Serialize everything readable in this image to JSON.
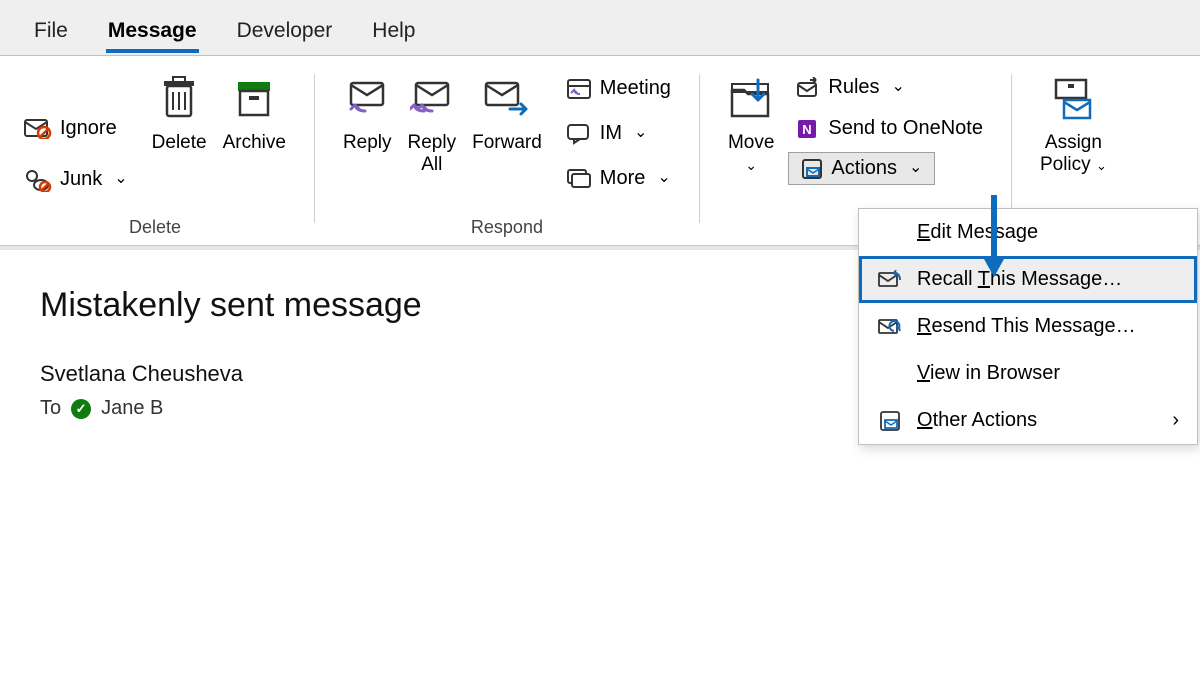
{
  "tabs": {
    "file": "File",
    "message": "Message",
    "developer": "Developer",
    "help": "Help"
  },
  "ribbon": {
    "ignore": "Ignore",
    "junk": "Junk",
    "delete": "Delete",
    "archive": "Archive",
    "reply": "Reply",
    "reply_all": "Reply\nAll",
    "forward": "Forward",
    "meeting": "Meeting",
    "im": "IM",
    "more": "More",
    "move": "Move",
    "rules": "Rules",
    "send_onenote": "Send to OneNote",
    "actions": "Actions",
    "assign_policy": "Assign\nPolicy",
    "group_delete": "Delete",
    "group_respond": "Respond"
  },
  "actions_menu": {
    "edit": "Edit Message",
    "recall": "Recall This Message…",
    "resend": "Resend This Message…",
    "view_browser": "View in Browser",
    "other": "Other Actions"
  },
  "message": {
    "subject": "Mistakenly sent message",
    "sender": "Svetlana Cheusheva",
    "to_label": "To",
    "recipient": "Jane B"
  }
}
